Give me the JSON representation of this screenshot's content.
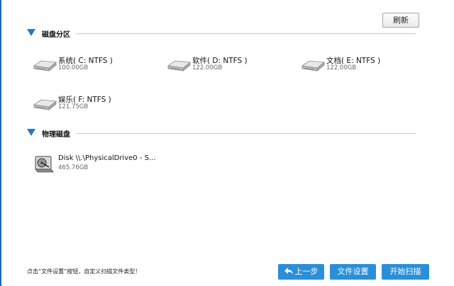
{
  "toolbar": {
    "refresh_label": "刷新"
  },
  "sections": {
    "partitions": {
      "title": "磁盘分区"
    },
    "physical": {
      "title": "物理磁盘"
    }
  },
  "partitions": [
    {
      "label": "系统( C: NTFS )",
      "size": "100.00GB",
      "icon": "hard-drive-icon"
    },
    {
      "label": "软件( D: NTFS )",
      "size": "122.00GB",
      "icon": "hard-drive-icon"
    },
    {
      "label": "文档( E: NTFS )",
      "size": "122.00GB",
      "icon": "hard-drive-icon"
    },
    {
      "label": "娱乐( F: NTFS )",
      "size": "121.75GB",
      "icon": "hard-drive-icon"
    }
  ],
  "physical_disks": [
    {
      "label": "Disk \\\\.\\PhysicalDrive0 - S...",
      "size": "465.76GB",
      "icon": "physical-disk-icon"
    }
  ],
  "footer": {
    "hint": "点击“文件设置”按钮，自定义扫描文件类型！",
    "back_label": "上一步",
    "file_settings_label": "文件设置",
    "start_scan_label": "开始扫描"
  },
  "colors": {
    "accent": "#2a8fd8",
    "triangle": "#1f7bd0",
    "border": "#1e67b1"
  }
}
